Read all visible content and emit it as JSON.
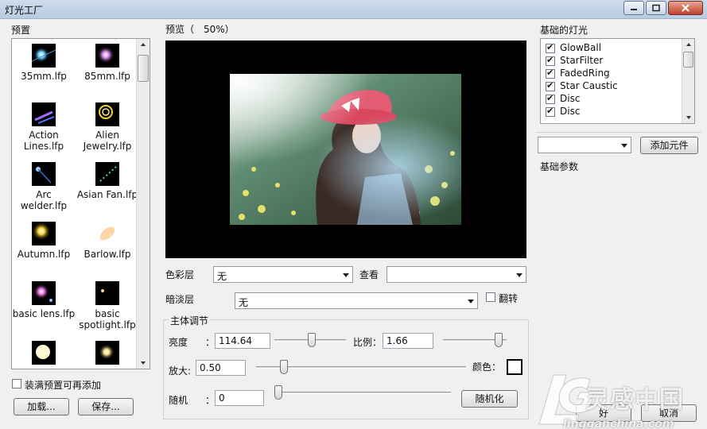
{
  "window": {
    "title": "灯光工厂"
  },
  "presets_panel": {
    "label": "预置",
    "items": [
      {
        "label": "35mm.lfp"
      },
      {
        "label": "85mm.lfp"
      },
      {
        "label": "Action Lines.lfp"
      },
      {
        "label": "Alien Jewelry.lfp"
      },
      {
        "label": "Arc welder.lfp"
      },
      {
        "label": "Asian Fan.lfp"
      },
      {
        "label": "Autumn.lfp"
      },
      {
        "label": "Barlow.lfp"
      },
      {
        "label": "basic lens.lfp"
      },
      {
        "label": "basic spotlight.lfp"
      },
      {
        "label": ""
      },
      {
        "label": ""
      }
    ],
    "fill_checkbox_label": "装满预置可再添加",
    "load_button": "加载...",
    "save_button": "保存..."
  },
  "preview": {
    "label": "预览（　50%）"
  },
  "controls": {
    "color_layer_label": "色彩层",
    "color_layer_value": "无",
    "view_label": "查看",
    "view_value": "",
    "shade_layer_label": "暗淡层",
    "shade_layer_value": "无",
    "flip_label": "翻转",
    "main_group_label": "主体调节",
    "brightness_label": "亮度",
    "brightness_colon": "：",
    "brightness_value": "114.64",
    "brightness_level": 0.53,
    "scale_label": "比例：",
    "scale_value": "1.66",
    "scale_level": 0.93,
    "zoom_label": "放大:",
    "zoom_value": "0.50",
    "zoom_level": 0.03,
    "color_label": "颜色：",
    "color_swatch": "#ffffff",
    "random_label": "随机",
    "random_colon": "：",
    "random_value": "0",
    "random_level": 0.0,
    "randomize_button": "随机化"
  },
  "lights_panel": {
    "label": "基础的灯光",
    "items": [
      {
        "label": "GlowBall",
        "checked": true
      },
      {
        "label": "StarFilter",
        "checked": true
      },
      {
        "label": "FadedRing",
        "checked": true
      },
      {
        "label": "Star Caustic",
        "checked": true
      },
      {
        "label": "Disc",
        "checked": true
      },
      {
        "label": "Disc",
        "checked": true
      }
    ],
    "element_combo_value": "",
    "add_element_button": "添加元件",
    "params_label": "基础参数"
  },
  "footer": {
    "ok_button": "好",
    "cancel_button": "取消"
  },
  "watermark": {
    "text": "灵感中国",
    "url": "lingganchina.com"
  }
}
